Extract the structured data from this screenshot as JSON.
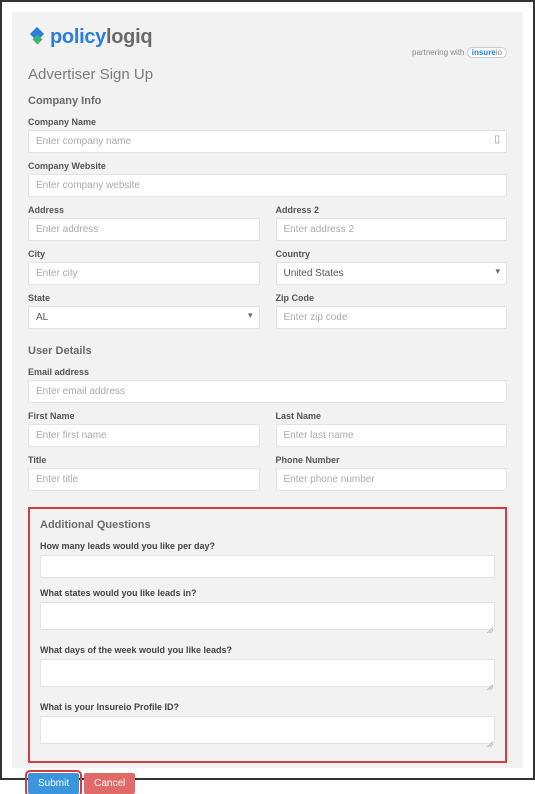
{
  "logo": {
    "policy": "policy",
    "logiq": "logiq",
    "partnering": "partnering with",
    "insure": "insure",
    "io": "io"
  },
  "page_title": "Advertiser Sign Up",
  "sections": {
    "company": "Company Info",
    "user": "User Details",
    "additional": "Additional Questions"
  },
  "fields": {
    "company_name": {
      "label": "Company Name",
      "placeholder": "Enter company name"
    },
    "company_website": {
      "label": "Company Website",
      "placeholder": "Enter company website"
    },
    "address": {
      "label": "Address",
      "placeholder": "Enter address"
    },
    "address2": {
      "label": "Address 2",
      "placeholder": "Enter address 2"
    },
    "city": {
      "label": "City",
      "placeholder": "Enter city"
    },
    "country": {
      "label": "Country",
      "value": "United States"
    },
    "state": {
      "label": "State",
      "value": "AL"
    },
    "zip": {
      "label": "Zip Code",
      "placeholder": "Enter zip code"
    },
    "email": {
      "label": "Email address",
      "placeholder": "Enter email address"
    },
    "first_name": {
      "label": "First Name",
      "placeholder": "Enter first name"
    },
    "last_name": {
      "label": "Last Name",
      "placeholder": "Enter last name"
    },
    "title": {
      "label": "Title",
      "placeholder": "Enter title"
    },
    "phone": {
      "label": "Phone Number",
      "placeholder": "Enter phone number"
    }
  },
  "questions": {
    "q1": "How many leads would you like per day?",
    "q2": "What states would you like leads in?",
    "q3": "What days of the week would you like leads?",
    "q4": "What is your Insureio Profile ID?"
  },
  "buttons": {
    "submit": "Submit",
    "cancel": "Cancel"
  }
}
